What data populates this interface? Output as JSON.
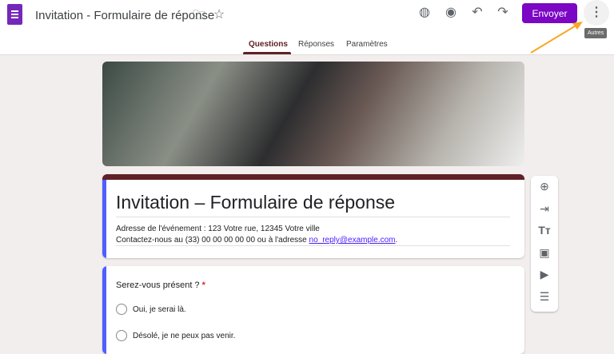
{
  "header": {
    "title": "Invitation - Formulaire de réponse",
    "send_label": "Envoyer",
    "more_tooltip": "Autres"
  },
  "tabs": [
    {
      "label": "Questions"
    },
    {
      "label": "Réponses"
    },
    {
      "label": "Paramètres"
    }
  ],
  "form": {
    "title": "Invitation – Formulaire de réponse",
    "address": "Adresse de l'événement : 123 Votre rue, 12345 Votre ville",
    "contact_prefix": "Contactez-nous au (33) 00 00 00 00 00 ou à l'adresse ",
    "email": "no_reply@example.com",
    "contact_suffix": "."
  },
  "question": {
    "label": "Serez-vous présent ?",
    "required_mark": "*",
    "options": [
      "Oui, je serai là.",
      "Désolé, je ne peux pas venir."
    ]
  },
  "colors": {
    "brand": "#7b06c4",
    "theme": "#5f2127",
    "accent": "#4d5fff",
    "annotation_arrow": "#f9a825"
  }
}
